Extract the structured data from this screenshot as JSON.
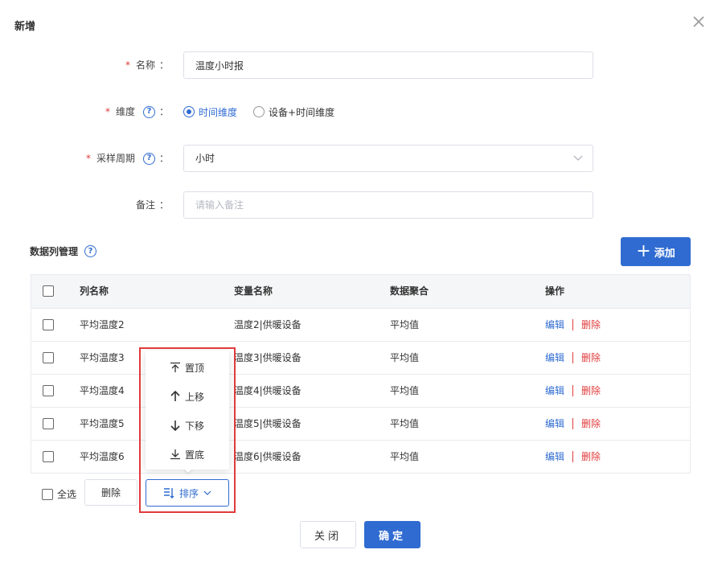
{
  "dialog": {
    "title": "新增"
  },
  "form": {
    "name": {
      "label": "名称",
      "value": "温度小时报"
    },
    "dimension": {
      "label": "维度",
      "options": [
        {
          "label": "时间维度",
          "checked": true
        },
        {
          "label": "设备+时间维度",
          "checked": false
        }
      ]
    },
    "period": {
      "label": "采样周期",
      "value": "小时"
    },
    "remark": {
      "label": "备注",
      "placeholder": "请输入备注"
    },
    "colon": "："
  },
  "columns_section": {
    "title": "数据列管理",
    "add_label": "添加"
  },
  "table": {
    "headers": [
      "列名称",
      "变量名称",
      "数据聚合",
      "操作"
    ],
    "edit_label": "编辑",
    "delete_label": "删除",
    "rows": [
      {
        "name": "平均温度2",
        "var": "温度2|供暖设备",
        "agg": "平均值"
      },
      {
        "name": "平均温度3",
        "var": "温度3|供暖设备",
        "agg": "平均值"
      },
      {
        "name": "平均温度4",
        "var": "温度4|供暖设备",
        "agg": "平均值"
      },
      {
        "name": "平均温度5",
        "var": "温度5|供暖设备",
        "agg": "平均值"
      },
      {
        "name": "平均温度6",
        "var": "温度6|供暖设备",
        "agg": "平均值"
      }
    ]
  },
  "footer": {
    "select_all": "全选",
    "delete": "删除",
    "sort": "排序"
  },
  "sort_menu": {
    "items": [
      "置顶",
      "上移",
      "下移",
      "置底"
    ]
  },
  "actions": {
    "close": "关闭",
    "confirm": "确定"
  },
  "colors": {
    "primary": "#2f6bd1",
    "danger": "#e03b3b"
  }
}
